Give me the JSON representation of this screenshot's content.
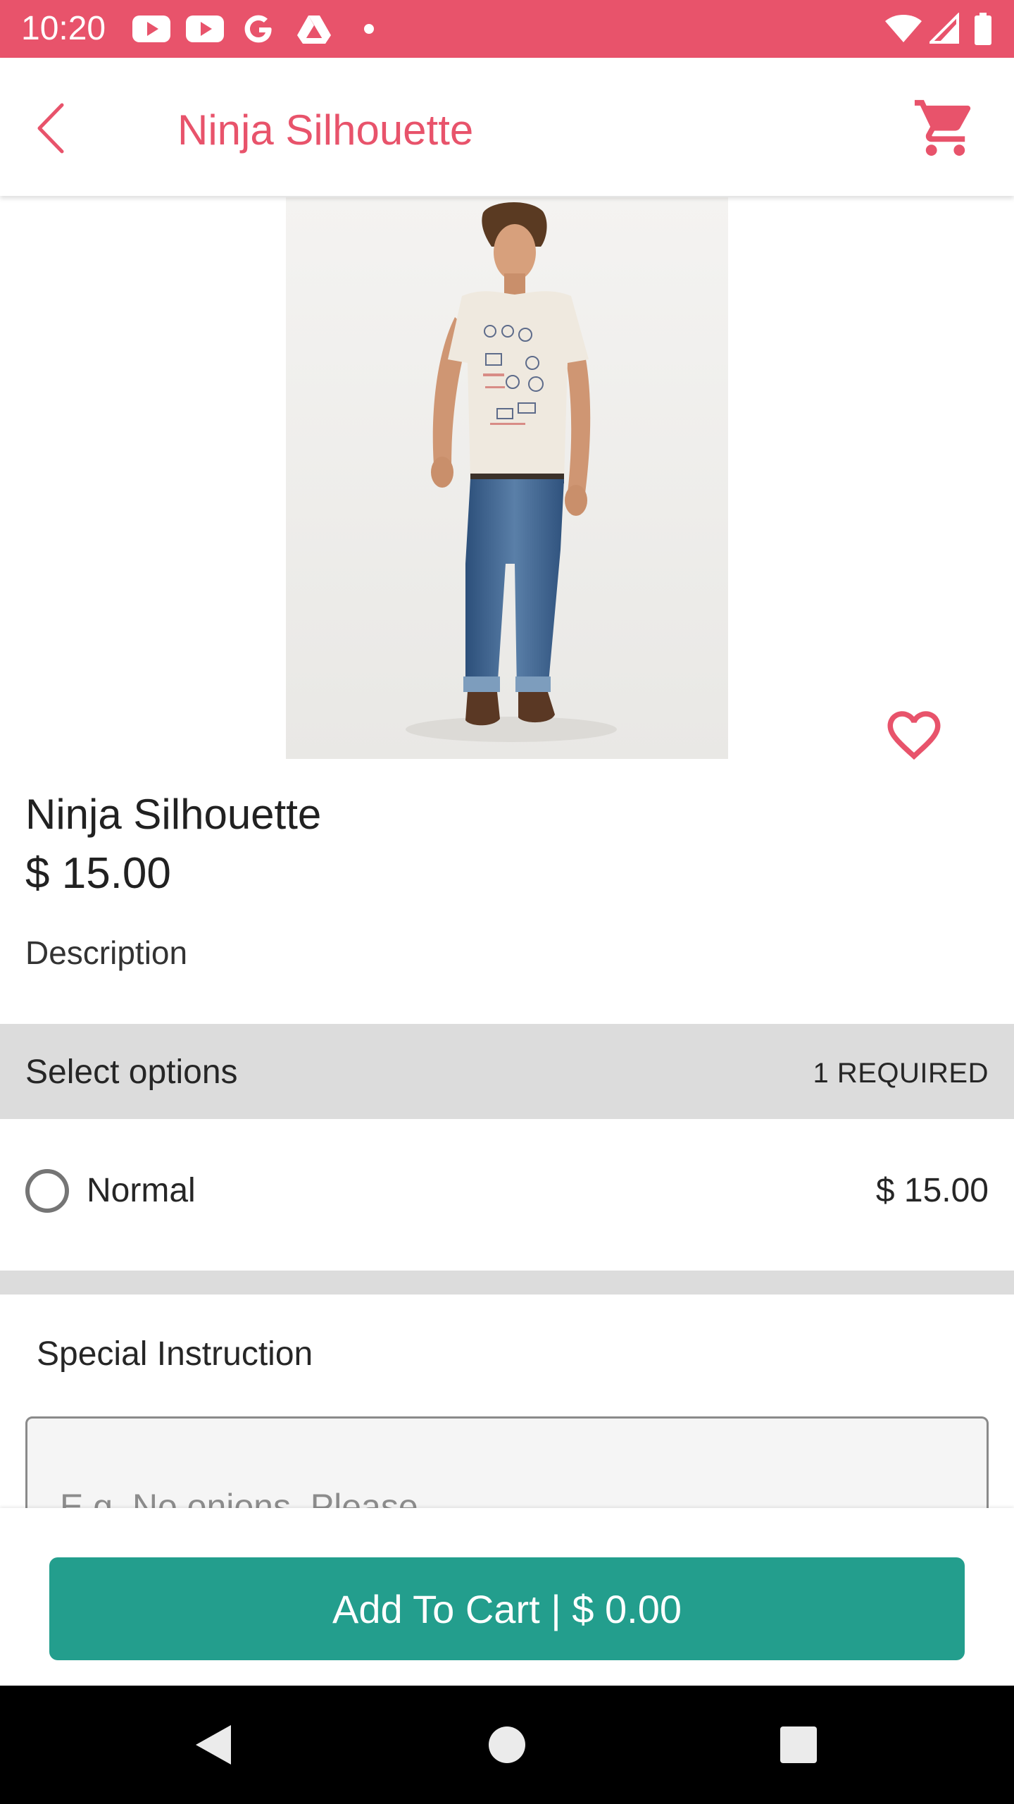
{
  "status_bar": {
    "time": "10:20",
    "background": "#E8536B",
    "icons": [
      "youtube-icon",
      "youtube-icon",
      "google-icon",
      "drive-icon",
      "dot-icon",
      "wifi-icon",
      "signal-icon",
      "battery-icon"
    ]
  },
  "app_bar": {
    "title": "Ninja Silhouette",
    "accent": "#E8536B",
    "back_icon": "chevron-left-icon",
    "cart_icon": "cart-icon"
  },
  "product": {
    "name": "Ninja Silhouette",
    "price": "$ 15.00",
    "description_label": "Description",
    "favorite_icon": "heart-outline-icon"
  },
  "options": {
    "title": "Select options",
    "required": "1 REQUIRED",
    "items": [
      {
        "label": "Normal",
        "price": "$ 15.00",
        "selected": false
      }
    ]
  },
  "special_instruction": {
    "label": "Special Instruction",
    "placeholder": "E.g. No onions, Please",
    "value": ""
  },
  "cart_button": {
    "label": "Add To Cart | $ 0.00",
    "color": "#239E8D"
  },
  "nav_bar": {
    "icons": [
      "back-triangle-icon",
      "home-circle-icon",
      "recents-square-icon"
    ]
  }
}
